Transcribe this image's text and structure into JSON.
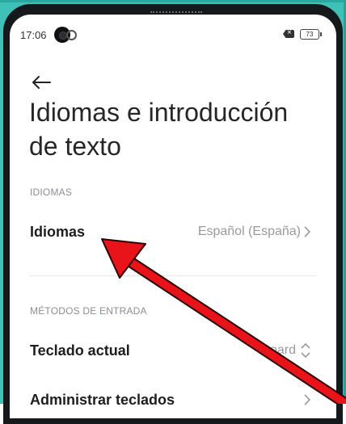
{
  "status_bar": {
    "time": "17:06",
    "battery": "73"
  },
  "header": {
    "title": "Idiomas e introducción de texto"
  },
  "sections": {
    "languages_label": "IDIOMAS",
    "input_methods_label": "MÉTODOS DE ENTRADA"
  },
  "rows": {
    "languages": {
      "label": "Idiomas",
      "value": "Español (España)"
    },
    "current_keyboard": {
      "label": "Teclado actual",
      "value": "board"
    },
    "manage_keyboards": {
      "label": "Administrar teclados"
    }
  },
  "colors": {
    "frame": "#3fc1b8",
    "annotation_arrow": "#e8141a"
  },
  "icons": {
    "back": "arrow-left-icon",
    "chevron": "chevron-right-icon",
    "updown": "chevron-updown-icon"
  }
}
